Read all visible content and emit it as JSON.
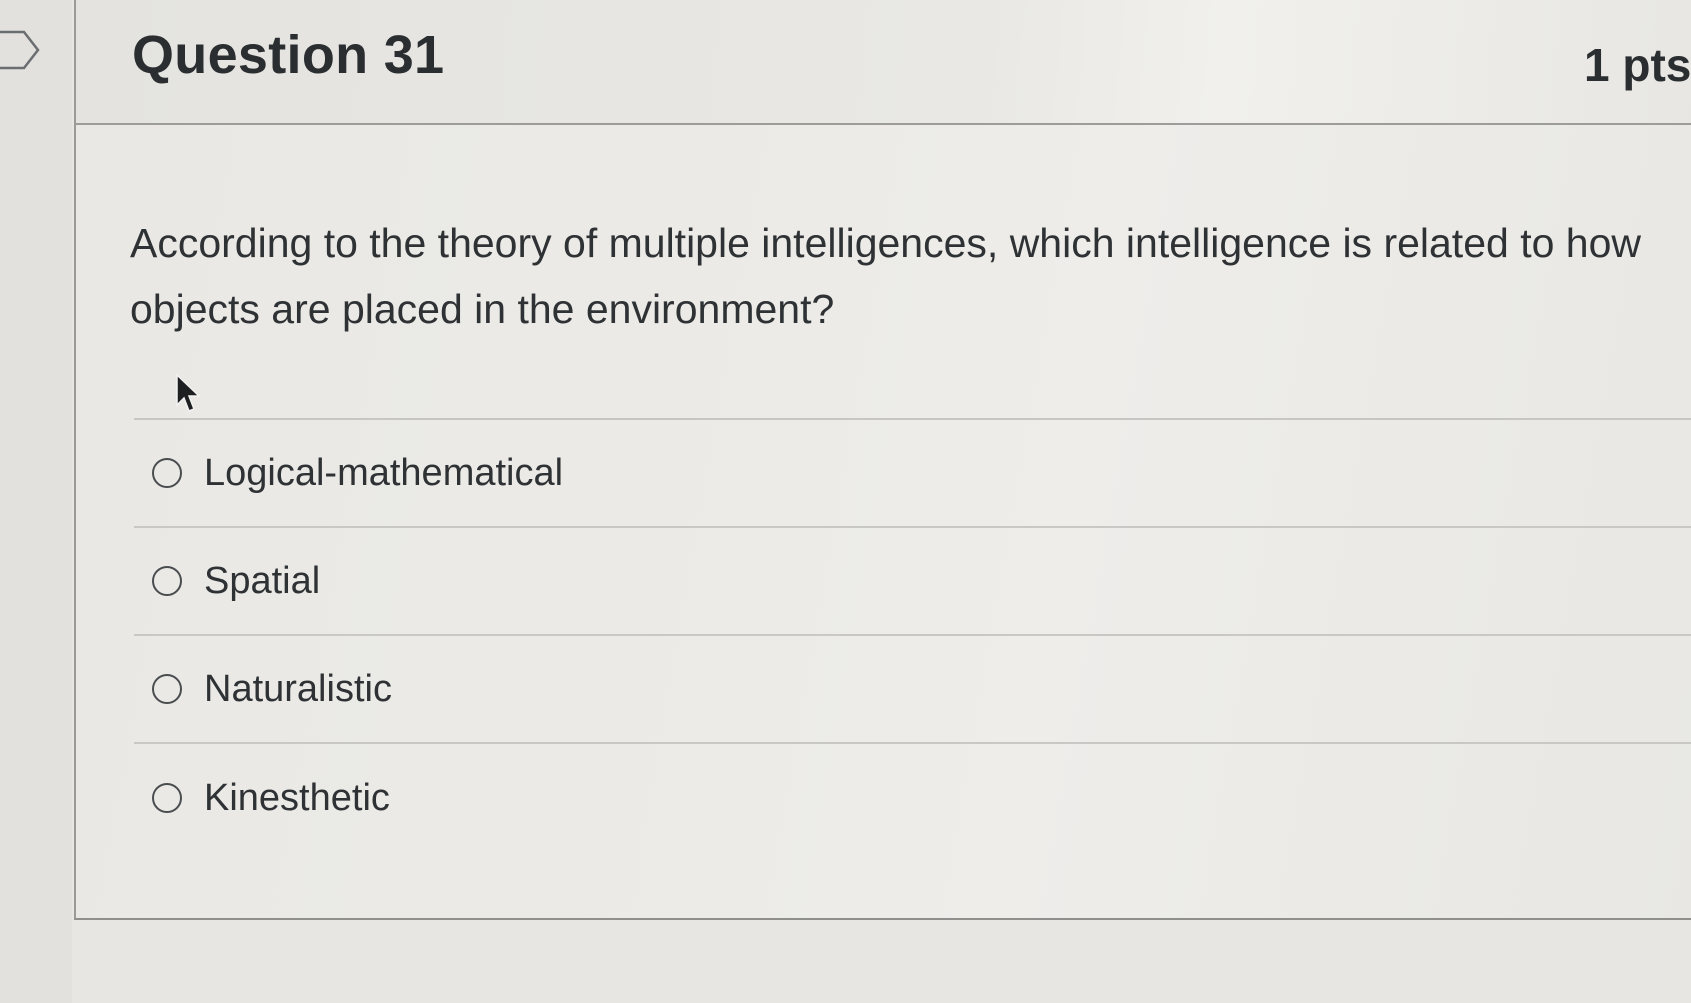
{
  "question": {
    "title": "Question 31",
    "points": "1 pts",
    "text": "According to the theory of multiple intelligences, which intelligence is related to how objects are placed in the environment?"
  },
  "answers": [
    {
      "label": "Logical-mathematical",
      "selected": false
    },
    {
      "label": "Spatial",
      "selected": false
    },
    {
      "label": "Naturalistic",
      "selected": false
    },
    {
      "label": "Kinesthetic",
      "selected": false
    }
  ],
  "icons": {
    "flag": "flag-marker-icon",
    "cursor": "mouse-pointer-icon",
    "radio": "radio-button-unchecked"
  },
  "colors": {
    "background": "#e7e6e2",
    "text": "#2f3235",
    "divider": "#c7c6c2"
  }
}
